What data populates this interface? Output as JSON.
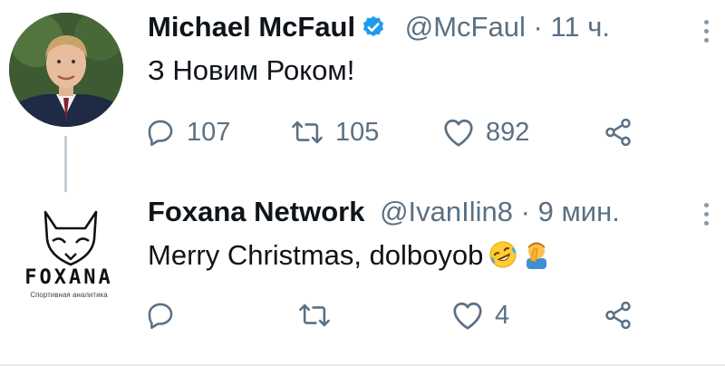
{
  "tweets": [
    {
      "author_name": "Michael McFaul",
      "handle": "@McFaul",
      "separator": "·",
      "time": "11 ч.",
      "text": "З Новим Роком!",
      "replies": "107",
      "retweets": "105",
      "likes": "892",
      "verified": true,
      "avatar_icon": "person-portrait-icon"
    },
    {
      "author_name": "Foxana Network",
      "handle": "@IvanIlin8",
      "separator": "·",
      "time": "9 мин.",
      "text": "Merry Christmas, dolboyob",
      "replies": "",
      "retweets": "",
      "likes": "4",
      "avatar_logo_text": "FOXANA",
      "avatar_logo_subtext": "Спортивная аналитика"
    }
  ],
  "colors": {
    "accent": "#1d9bf0",
    "muted": "#5b7083",
    "thread_line": "#c4cfd6"
  }
}
